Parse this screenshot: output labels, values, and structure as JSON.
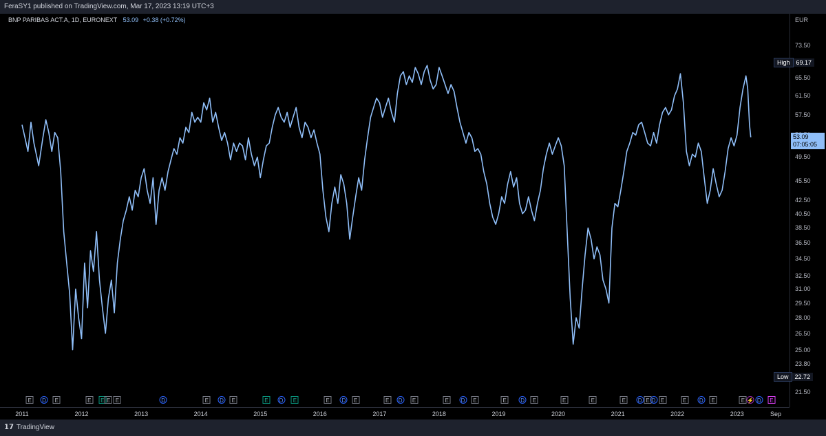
{
  "header": {
    "publisher": "FeraSY1 published on TradingView.com, Mar 17, 2023 13:19 UTC+3"
  },
  "legend": {
    "symbol": "BNP PARIBAS ACT.A, 1D, EURONEXT",
    "last": "53.09",
    "change": "+0.38 (+0.72%)"
  },
  "footer": {
    "brand": "TradingView",
    "logo": "tradingview-logo-icon"
  },
  "colors": {
    "background": "#000000",
    "line": "#90bff9",
    "panel": "#1e222d"
  },
  "chart_data": {
    "type": "line",
    "currency": "EUR",
    "y_scale": "log",
    "ylim": [
      20.6,
      79.5
    ],
    "y_ticks": [
      "73.50",
      "65.50",
      "61.50",
      "57.50",
      "53.50",
      "49.50",
      "45.50",
      "42.50",
      "40.50",
      "38.50",
      "36.50",
      "34.50",
      "32.50",
      "31.00",
      "29.50",
      "28.00",
      "26.50",
      "25.00",
      "23.80",
      "21.50"
    ],
    "x_ticks": [
      "2011",
      "2012",
      "2013",
      "2014",
      "2015",
      "2016",
      "2017",
      "2018",
      "2019",
      "2020",
      "2021",
      "2022",
      "2023",
      "Sep"
    ],
    "high": {
      "label": "High",
      "value": "69.17"
    },
    "low": {
      "label": "Low",
      "value": "22.72"
    },
    "last_price": {
      "value": "53.09",
      "countdown": "07:05:05"
    },
    "series": [
      {
        "values": [
          [
            2011.0,
            55.5
          ],
          [
            2011.05,
            53.0
          ],
          [
            2011.1,
            50.5
          ],
          [
            2011.15,
            56.0
          ],
          [
            2011.2,
            52.0
          ],
          [
            2011.28,
            48.0
          ],
          [
            2011.35,
            53.0
          ],
          [
            2011.4,
            56.5
          ],
          [
            2011.45,
            54.0
          ],
          [
            2011.5,
            50.5
          ],
          [
            2011.55,
            54.0
          ],
          [
            2011.6,
            53.0
          ],
          [
            2011.65,
            47.0
          ],
          [
            2011.7,
            38.0
          ],
          [
            2011.75,
            34.0
          ],
          [
            2011.8,
            30.5
          ],
          [
            2011.85,
            25.0
          ],
          [
            2011.9,
            31.0
          ],
          [
            2011.95,
            28.0
          ],
          [
            2012.0,
            26.0
          ],
          [
            2012.05,
            34.0
          ],
          [
            2012.1,
            29.0
          ],
          [
            2012.15,
            35.5
          ],
          [
            2012.2,
            33.0
          ],
          [
            2012.25,
            38.0
          ],
          [
            2012.3,
            32.0
          ],
          [
            2012.35,
            29.0
          ],
          [
            2012.4,
            26.5
          ],
          [
            2012.45,
            30.0
          ],
          [
            2012.5,
            32.0
          ],
          [
            2012.55,
            28.5
          ],
          [
            2012.6,
            34.0
          ],
          [
            2012.65,
            37.0
          ],
          [
            2012.7,
            39.5
          ],
          [
            2012.75,
            41.0
          ],
          [
            2012.8,
            43.0
          ],
          [
            2012.85,
            41.0
          ],
          [
            2012.9,
            44.0
          ],
          [
            2012.95,
            43.0
          ],
          [
            2013.0,
            46.0
          ],
          [
            2013.05,
            47.5
          ],
          [
            2013.1,
            44.0
          ],
          [
            2013.15,
            42.0
          ],
          [
            2013.2,
            46.0
          ],
          [
            2013.25,
            39.0
          ],
          [
            2013.3,
            44.0
          ],
          [
            2013.35,
            46.0
          ],
          [
            2013.4,
            44.0
          ],
          [
            2013.45,
            47.0
          ],
          [
            2013.5,
            49.0
          ],
          [
            2013.55,
            51.0
          ],
          [
            2013.6,
            50.0
          ],
          [
            2013.65,
            53.0
          ],
          [
            2013.7,
            52.0
          ],
          [
            2013.75,
            55.0
          ],
          [
            2013.8,
            54.0
          ],
          [
            2013.85,
            58.0
          ],
          [
            2013.9,
            56.0
          ],
          [
            2013.95,
            57.0
          ],
          [
            2014.0,
            56.0
          ],
          [
            2014.05,
            60.0
          ],
          [
            2014.1,
            58.5
          ],
          [
            2014.15,
            61.0
          ],
          [
            2014.2,
            56.0
          ],
          [
            2014.25,
            58.0
          ],
          [
            2014.3,
            55.0
          ],
          [
            2014.35,
            52.5
          ],
          [
            2014.4,
            54.0
          ],
          [
            2014.45,
            52.0
          ],
          [
            2014.5,
            49.0
          ],
          [
            2014.55,
            52.0
          ],
          [
            2014.6,
            50.5
          ],
          [
            2014.65,
            52.0
          ],
          [
            2014.7,
            51.5
          ],
          [
            2014.75,
            49.0
          ],
          [
            2014.8,
            53.0
          ],
          [
            2014.85,
            50.0
          ],
          [
            2014.9,
            48.0
          ],
          [
            2014.95,
            49.5
          ],
          [
            2015.0,
            46.0
          ],
          [
            2015.05,
            49.0
          ],
          [
            2015.1,
            51.5
          ],
          [
            2015.15,
            52.0
          ],
          [
            2015.2,
            55.0
          ],
          [
            2015.25,
            57.5
          ],
          [
            2015.3,
            59.0
          ],
          [
            2015.35,
            57.0
          ],
          [
            2015.4,
            56.0
          ],
          [
            2015.45,
            58.0
          ],
          [
            2015.5,
            55.0
          ],
          [
            2015.55,
            57.0
          ],
          [
            2015.6,
            59.0
          ],
          [
            2015.65,
            55.0
          ],
          [
            2015.7,
            53.0
          ],
          [
            2015.75,
            56.0
          ],
          [
            2015.8,
            55.0
          ],
          [
            2015.85,
            53.0
          ],
          [
            2015.9,
            54.5
          ],
          [
            2015.95,
            52.0
          ],
          [
            2016.0,
            50.0
          ],
          [
            2016.05,
            44.0
          ],
          [
            2016.1,
            40.0
          ],
          [
            2016.15,
            38.0
          ],
          [
            2016.2,
            42.0
          ],
          [
            2016.25,
            44.5
          ],
          [
            2016.3,
            42.0
          ],
          [
            2016.35,
            46.5
          ],
          [
            2016.4,
            45.0
          ],
          [
            2016.45,
            42.0
          ],
          [
            2016.5,
            37.0
          ],
          [
            2016.55,
            40.0
          ],
          [
            2016.6,
            43.0
          ],
          [
            2016.65,
            46.0
          ],
          [
            2016.7,
            44.0
          ],
          [
            2016.75,
            49.0
          ],
          [
            2016.8,
            53.0
          ],
          [
            2016.85,
            57.0
          ],
          [
            2016.9,
            59.0
          ],
          [
            2016.95,
            61.0
          ],
          [
            2017.0,
            60.0
          ],
          [
            2017.05,
            57.0
          ],
          [
            2017.1,
            59.0
          ],
          [
            2017.15,
            61.0
          ],
          [
            2017.2,
            58.0
          ],
          [
            2017.25,
            56.0
          ],
          [
            2017.3,
            62.0
          ],
          [
            2017.35,
            66.0
          ],
          [
            2017.4,
            67.0
          ],
          [
            2017.45,
            64.0
          ],
          [
            2017.5,
            66.0
          ],
          [
            2017.55,
            64.5
          ],
          [
            2017.6,
            68.0
          ],
          [
            2017.65,
            66.5
          ],
          [
            2017.7,
            64.0
          ],
          [
            2017.75,
            67.0
          ],
          [
            2017.8,
            68.5
          ],
          [
            2017.85,
            65.0
          ],
          [
            2017.9,
            63.0
          ],
          [
            2017.95,
            64.0
          ],
          [
            2018.0,
            68.0
          ],
          [
            2018.05,
            66.0
          ],
          [
            2018.1,
            64.0
          ],
          [
            2018.15,
            62.0
          ],
          [
            2018.2,
            64.0
          ],
          [
            2018.25,
            62.5
          ],
          [
            2018.3,
            59.0
          ],
          [
            2018.35,
            56.0
          ],
          [
            2018.4,
            54.0
          ],
          [
            2018.45,
            52.0
          ],
          [
            2018.5,
            54.0
          ],
          [
            2018.55,
            53.0
          ],
          [
            2018.6,
            50.5
          ],
          [
            2018.65,
            51.0
          ],
          [
            2018.7,
            50.0
          ],
          [
            2018.75,
            47.0
          ],
          [
            2018.8,
            45.0
          ],
          [
            2018.85,
            42.0
          ],
          [
            2018.9,
            40.0
          ],
          [
            2018.95,
            39.0
          ],
          [
            2019.0,
            40.5
          ],
          [
            2019.05,
            43.0
          ],
          [
            2019.1,
            42.0
          ],
          [
            2019.15,
            45.0
          ],
          [
            2019.2,
            47.0
          ],
          [
            2019.25,
            44.5
          ],
          [
            2019.3,
            46.0
          ],
          [
            2019.35,
            42.0
          ],
          [
            2019.4,
            40.5
          ],
          [
            2019.45,
            41.0
          ],
          [
            2019.5,
            43.0
          ],
          [
            2019.55,
            41.0
          ],
          [
            2019.6,
            39.5
          ],
          [
            2019.65,
            42.0
          ],
          [
            2019.7,
            44.0
          ],
          [
            2019.75,
            47.5
          ],
          [
            2019.8,
            50.0
          ],
          [
            2019.85,
            52.0
          ],
          [
            2019.9,
            50.0
          ],
          [
            2019.95,
            51.5
          ],
          [
            2020.0,
            53.0
          ],
          [
            2020.05,
            51.5
          ],
          [
            2020.1,
            48.0
          ],
          [
            2020.15,
            38.0
          ],
          [
            2020.2,
            30.0
          ],
          [
            2020.25,
            25.5
          ],
          [
            2020.3,
            28.0
          ],
          [
            2020.35,
            27.0
          ],
          [
            2020.4,
            31.0
          ],
          [
            2020.45,
            35.0
          ],
          [
            2020.5,
            38.5
          ],
          [
            2020.55,
            37.0
          ],
          [
            2020.6,
            34.5
          ],
          [
            2020.65,
            36.0
          ],
          [
            2020.7,
            35.0
          ],
          [
            2020.75,
            32.0
          ],
          [
            2020.8,
            31.0
          ],
          [
            2020.85,
            29.5
          ],
          [
            2020.9,
            38.5
          ],
          [
            2020.95,
            42.0
          ],
          [
            2021.0,
            41.5
          ],
          [
            2021.05,
            44.0
          ],
          [
            2021.1,
            47.0
          ],
          [
            2021.15,
            50.5
          ],
          [
            2021.2,
            52.0
          ],
          [
            2021.25,
            54.0
          ],
          [
            2021.3,
            53.5
          ],
          [
            2021.35,
            55.5
          ],
          [
            2021.4,
            56.0
          ],
          [
            2021.45,
            54.0
          ],
          [
            2021.5,
            52.0
          ],
          [
            2021.55,
            51.5
          ],
          [
            2021.6,
            54.0
          ],
          [
            2021.65,
            52.0
          ],
          [
            2021.7,
            55.5
          ],
          [
            2021.75,
            58.0
          ],
          [
            2021.8,
            59.0
          ],
          [
            2021.85,
            57.5
          ],
          [
            2021.9,
            58.5
          ],
          [
            2021.95,
            61.5
          ],
          [
            2022.0,
            63.0
          ],
          [
            2022.05,
            66.5
          ],
          [
            2022.1,
            60.0
          ],
          [
            2022.15,
            50.5
          ],
          [
            2022.2,
            48.0
          ],
          [
            2022.25,
            50.0
          ],
          [
            2022.3,
            49.5
          ],
          [
            2022.35,
            52.0
          ],
          [
            2022.4,
            50.5
          ],
          [
            2022.45,
            46.0
          ],
          [
            2022.5,
            42.0
          ],
          [
            2022.55,
            44.0
          ],
          [
            2022.6,
            47.5
          ],
          [
            2022.65,
            45.0
          ],
          [
            2022.7,
            43.0
          ],
          [
            2022.75,
            44.0
          ],
          [
            2022.8,
            47.0
          ],
          [
            2022.85,
            51.0
          ],
          [
            2022.9,
            53.0
          ],
          [
            2022.95,
            51.5
          ],
          [
            2023.0,
            53.5
          ],
          [
            2023.05,
            59.0
          ],
          [
            2023.1,
            63.0
          ],
          [
            2023.15,
            66.0
          ],
          [
            2023.18,
            63.0
          ],
          [
            2023.21,
            55.5
          ],
          [
            2023.23,
            53.09
          ]
        ]
      }
    ],
    "events": [
      {
        "x": 2011.13,
        "type": "E"
      },
      {
        "x": 2011.37,
        "type": "D"
      },
      {
        "x": 2011.58,
        "type": "E"
      },
      {
        "x": 2012.13,
        "type": "E"
      },
      {
        "x": 2012.35,
        "type": "EG"
      },
      {
        "x": 2012.45,
        "type": "E"
      },
      {
        "x": 2012.6,
        "type": "E"
      },
      {
        "x": 2013.37,
        "type": "D"
      },
      {
        "x": 2014.1,
        "type": "E"
      },
      {
        "x": 2014.35,
        "type": "D"
      },
      {
        "x": 2014.55,
        "type": "E"
      },
      {
        "x": 2015.1,
        "type": "EG"
      },
      {
        "x": 2015.35,
        "type": "D"
      },
      {
        "x": 2015.58,
        "type": "EG"
      },
      {
        "x": 2016.13,
        "type": "E"
      },
      {
        "x": 2016.4,
        "type": "D"
      },
      {
        "x": 2016.6,
        "type": "E"
      },
      {
        "x": 2017.13,
        "type": "E"
      },
      {
        "x": 2017.35,
        "type": "D"
      },
      {
        "x": 2017.58,
        "type": "E"
      },
      {
        "x": 2018.13,
        "type": "E"
      },
      {
        "x": 2018.4,
        "type": "D"
      },
      {
        "x": 2018.6,
        "type": "E"
      },
      {
        "x": 2019.1,
        "type": "E"
      },
      {
        "x": 2019.4,
        "type": "D"
      },
      {
        "x": 2019.6,
        "type": "E"
      },
      {
        "x": 2020.1,
        "type": "E"
      },
      {
        "x": 2020.58,
        "type": "E"
      },
      {
        "x": 2021.1,
        "type": "E"
      },
      {
        "x": 2021.37,
        "type": "D"
      },
      {
        "x": 2021.5,
        "type": "E"
      },
      {
        "x": 2021.6,
        "type": "D"
      },
      {
        "x": 2021.75,
        "type": "E"
      },
      {
        "x": 2022.12,
        "type": "E"
      },
      {
        "x": 2022.4,
        "type": "D"
      },
      {
        "x": 2022.6,
        "type": "E"
      },
      {
        "x": 2023.1,
        "type": "E"
      },
      {
        "x": 2023.22,
        "type": "S"
      },
      {
        "x": 2023.37,
        "type": "D"
      },
      {
        "x": 2023.58,
        "type": "EM"
      }
    ]
  }
}
